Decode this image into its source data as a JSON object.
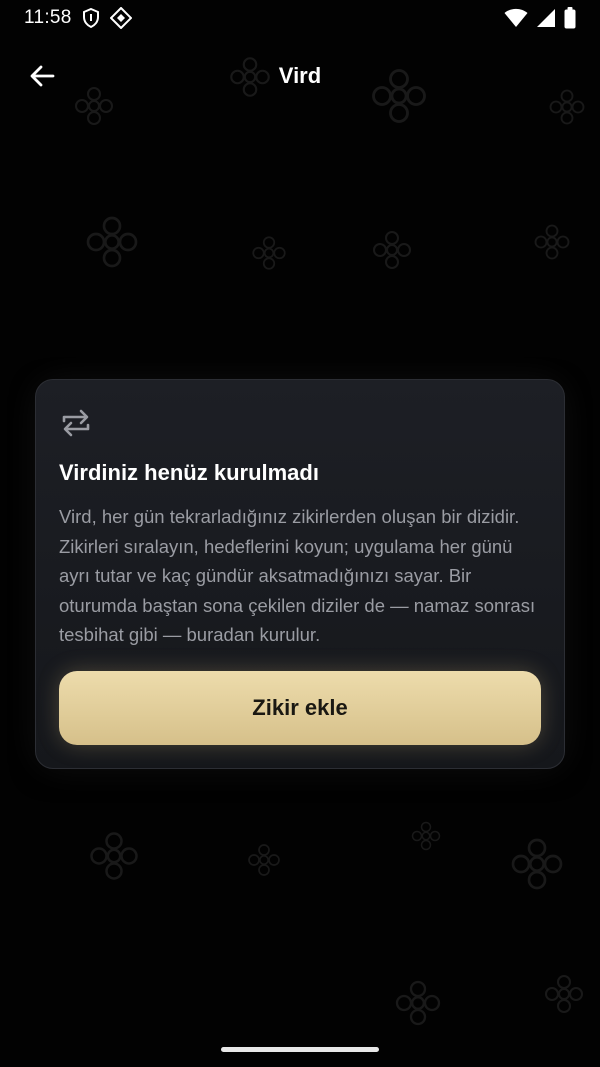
{
  "status_bar": {
    "time": "11:58",
    "icons": [
      "shield-icon",
      "sim-diamond-icon",
      "wifi-icon",
      "signal-icon",
      "battery-icon"
    ]
  },
  "app_bar": {
    "title": "Vird",
    "back_icon": "arrow-back-icon"
  },
  "empty_state": {
    "icon": "repeat-icon",
    "title": "Virdiniz henüz kurulmadı",
    "description": "Vird, her gün tekrarladığınız zikirlerden oluşan bir dizidir. Zikirleri sıralayın, hedeflerini koyun; uygulama her günü ayrı tutar ve kaç gündür aksatmadığınızı sayar. Bir oturumda baştan sona çekilen diziler de — namaz sonrası tesbihat gibi — buradan kurulur.",
    "button_label": "Zikir ekle"
  },
  "colors": {
    "background": "#020202",
    "card": "#1a1c21",
    "accent_button": "#e6d39f",
    "muted_text": "#9a9ca3"
  }
}
